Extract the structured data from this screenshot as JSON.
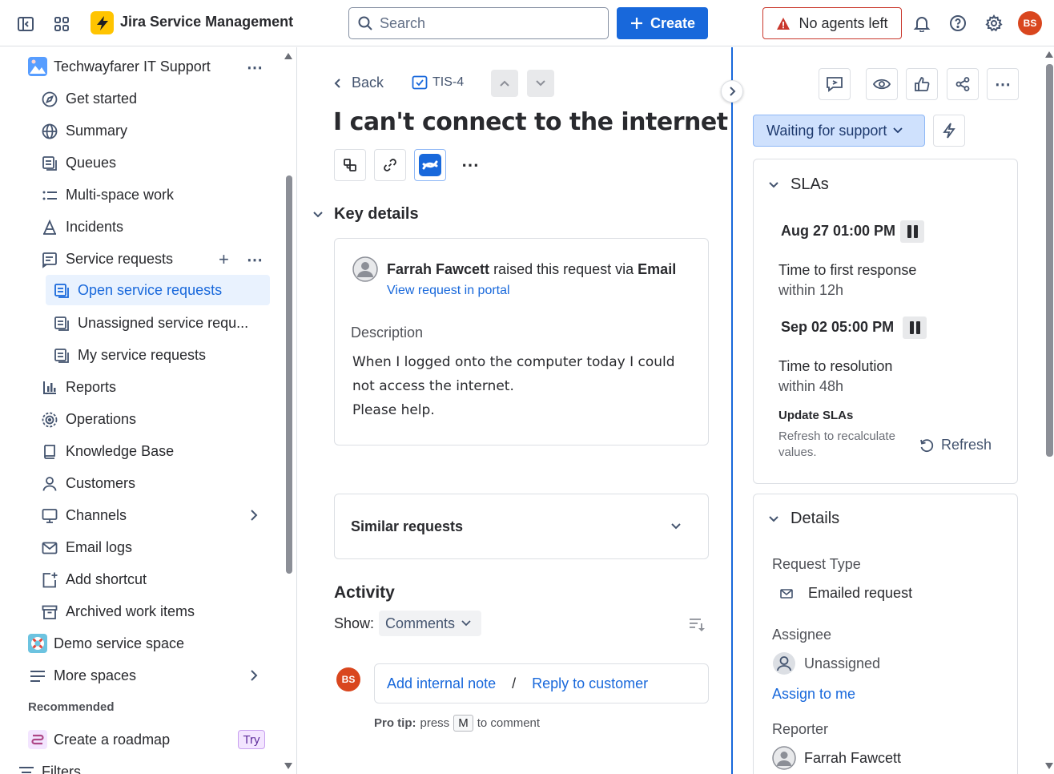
{
  "topbar": {
    "app_title": "Jira Service Management",
    "search_placeholder": "Search",
    "create_label": "Create",
    "agents_label": "No agents left",
    "avatar_initials": "BS"
  },
  "sidebar": {
    "space_name": "Techwayfarer IT Support",
    "items": [
      {
        "label": "Get started",
        "icon": "compass-icon"
      },
      {
        "label": "Summary",
        "icon": "globe-icon"
      },
      {
        "label": "Queues",
        "icon": "queue-icon"
      },
      {
        "label": "Multi-space work",
        "icon": "list-icon"
      },
      {
        "label": "Incidents",
        "icon": "incident-icon"
      },
      {
        "label": "Service requests",
        "icon": "request-icon"
      },
      {
        "label": "Open service requests",
        "icon": "queue-icon"
      },
      {
        "label": "Unassigned service requ...",
        "icon": "queue-icon"
      },
      {
        "label": "My service requests",
        "icon": "queue-icon"
      },
      {
        "label": "Reports",
        "icon": "chart-icon"
      },
      {
        "label": "Operations",
        "icon": "operations-icon"
      },
      {
        "label": "Knowledge Base",
        "icon": "book-icon"
      },
      {
        "label": "Customers",
        "icon": "person-icon"
      },
      {
        "label": "Channels",
        "icon": "monitor-icon"
      },
      {
        "label": "Email logs",
        "icon": "email-icon"
      },
      {
        "label": "Add shortcut",
        "icon": "add-shortcut-icon"
      },
      {
        "label": "Archived work items",
        "icon": "archive-icon"
      }
    ],
    "demo_space": "Demo service space",
    "more_spaces": "More spaces",
    "recommended": "Recommended",
    "roadmap": "Create a roadmap",
    "try_badge": "Try",
    "filters": "Filters"
  },
  "main": {
    "back_label": "Back",
    "issue_key": "TIS-4",
    "title": "I can't connect to the internet",
    "key_details": "Key details",
    "requester": "Farrah Fawcett",
    "raised_text": "raised this request via",
    "channel": "Email",
    "portal_link": "View request in portal",
    "description_label": "Description",
    "description_lines": [
      "When I logged onto the computer today I could",
      "not access the internet.",
      "Please help."
    ],
    "similar_requests": "Similar requests",
    "activity": "Activity",
    "show_label": "Show:",
    "show_value": "Comments",
    "add_note": "Add internal note",
    "separator": "/",
    "reply": "Reply to customer",
    "commenter_initials": "BS",
    "pro_tip_bold": "Pro tip:",
    "pro_tip_press": "press",
    "pro_tip_key": "M",
    "pro_tip_rest": "to comment"
  },
  "right": {
    "status": "Waiting for support",
    "slas_title": "SLAs",
    "sla1_date": "Aug 27 01:00 PM",
    "sla1_name": "Time to first response",
    "sla1_within": "within 12h",
    "sla2_date": "Sep 02 05:00 PM",
    "sla2_name": "Time to resolution",
    "sla2_within": "within 48h",
    "update_slas": "Update SLAs",
    "refresh_hint_1": "Refresh to recalculate",
    "refresh_hint_2": "values.",
    "refresh_label": "Refresh",
    "details_title": "Details",
    "request_type_label": "Request Type",
    "request_type_value": "Emailed request",
    "assignee_label": "Assignee",
    "assignee_value": "Unassigned",
    "assign_to_me": "Assign to me",
    "reporter_label": "Reporter",
    "reporter_value": "Farrah Fawcett"
  },
  "colors": {
    "brand_blue": "#1868DB",
    "logo_yellow": "#FFC400",
    "danger_red": "#C9372C",
    "avatar_orange": "#D9461E",
    "status_bg": "#CFE1FD"
  }
}
